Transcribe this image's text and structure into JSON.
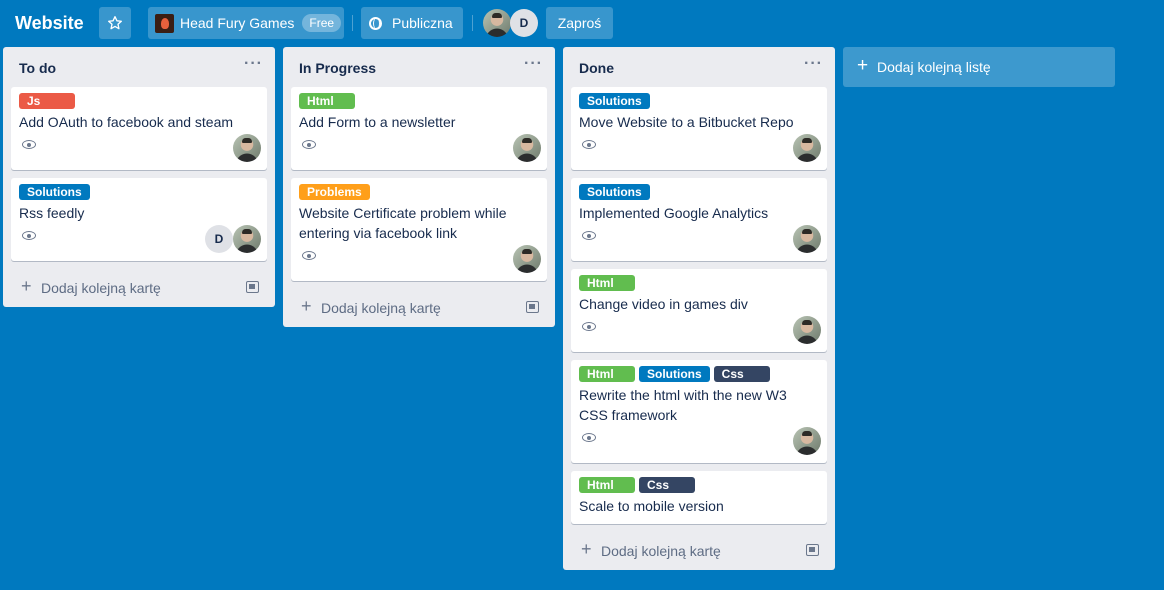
{
  "header": {
    "board_title": "Website",
    "team_name": "Head Fury Games",
    "team_plan": "Free",
    "visibility": "Publiczna",
    "member_initial": "D",
    "invite_label": "Zaproś"
  },
  "colors": {
    "background": "#0079bf",
    "label_green": "#61bd4f",
    "label_blue": "#0079bf",
    "label_red": "#eb5a46",
    "label_orange": "#ff9f1a",
    "label_navy": "#344563"
  },
  "icons": {
    "star": "star-icon",
    "globe": "globe-icon",
    "eye": "eye-icon",
    "plus": "plus-icon",
    "template": "card-template-icon",
    "menu": "ellipsis-icon"
  },
  "add_card_label": "Dodaj kolejną kartę",
  "add_list_label": "Dodaj kolejną listę",
  "lists": [
    {
      "title": "To do",
      "cards": [
        {
          "labels": [
            {
              "text": "Js",
              "color": "#eb5a46"
            }
          ],
          "title": "Add OAuth to facebook and steam",
          "members": [
            "avatar"
          ]
        },
        {
          "labels": [
            {
              "text": "Solutions",
              "color": "#0079bf"
            }
          ],
          "title": "Rss feedly",
          "members": [
            "D",
            "avatar"
          ]
        }
      ]
    },
    {
      "title": "In Progress",
      "cards": [
        {
          "labels": [
            {
              "text": "Html",
              "color": "#61bd4f"
            }
          ],
          "title": "Add Form to a newsletter",
          "members": [
            "avatar"
          ]
        },
        {
          "labels": [
            {
              "text": "Problems",
              "color": "#ff9f1a"
            }
          ],
          "title": "Website Certificate problem while entering via facebook link",
          "members": [
            "avatar"
          ]
        }
      ]
    },
    {
      "title": "Done",
      "cards": [
        {
          "labels": [
            {
              "text": "Solutions",
              "color": "#0079bf"
            }
          ],
          "title": "Move Website to a Bitbucket Repo",
          "members": [
            "avatar"
          ]
        },
        {
          "labels": [
            {
              "text": "Solutions",
              "color": "#0079bf"
            }
          ],
          "title": "Implemented Google Analytics",
          "members": [
            "avatar"
          ]
        },
        {
          "labels": [
            {
              "text": "Html",
              "color": "#61bd4f"
            }
          ],
          "title": "Change video in games div",
          "members": [
            "avatar"
          ]
        },
        {
          "labels": [
            {
              "text": "Html",
              "color": "#61bd4f"
            },
            {
              "text": "Solutions",
              "color": "#0079bf"
            },
            {
              "text": "Css",
              "color": "#344563"
            }
          ],
          "title": "Rewrite the html with the new W3 CSS framework",
          "members": [
            "avatar"
          ]
        },
        {
          "labels": [
            {
              "text": "Html",
              "color": "#61bd4f"
            },
            {
              "text": "Css",
              "color": "#344563"
            }
          ],
          "title": "Scale to mobile version",
          "members": []
        }
      ]
    }
  ]
}
